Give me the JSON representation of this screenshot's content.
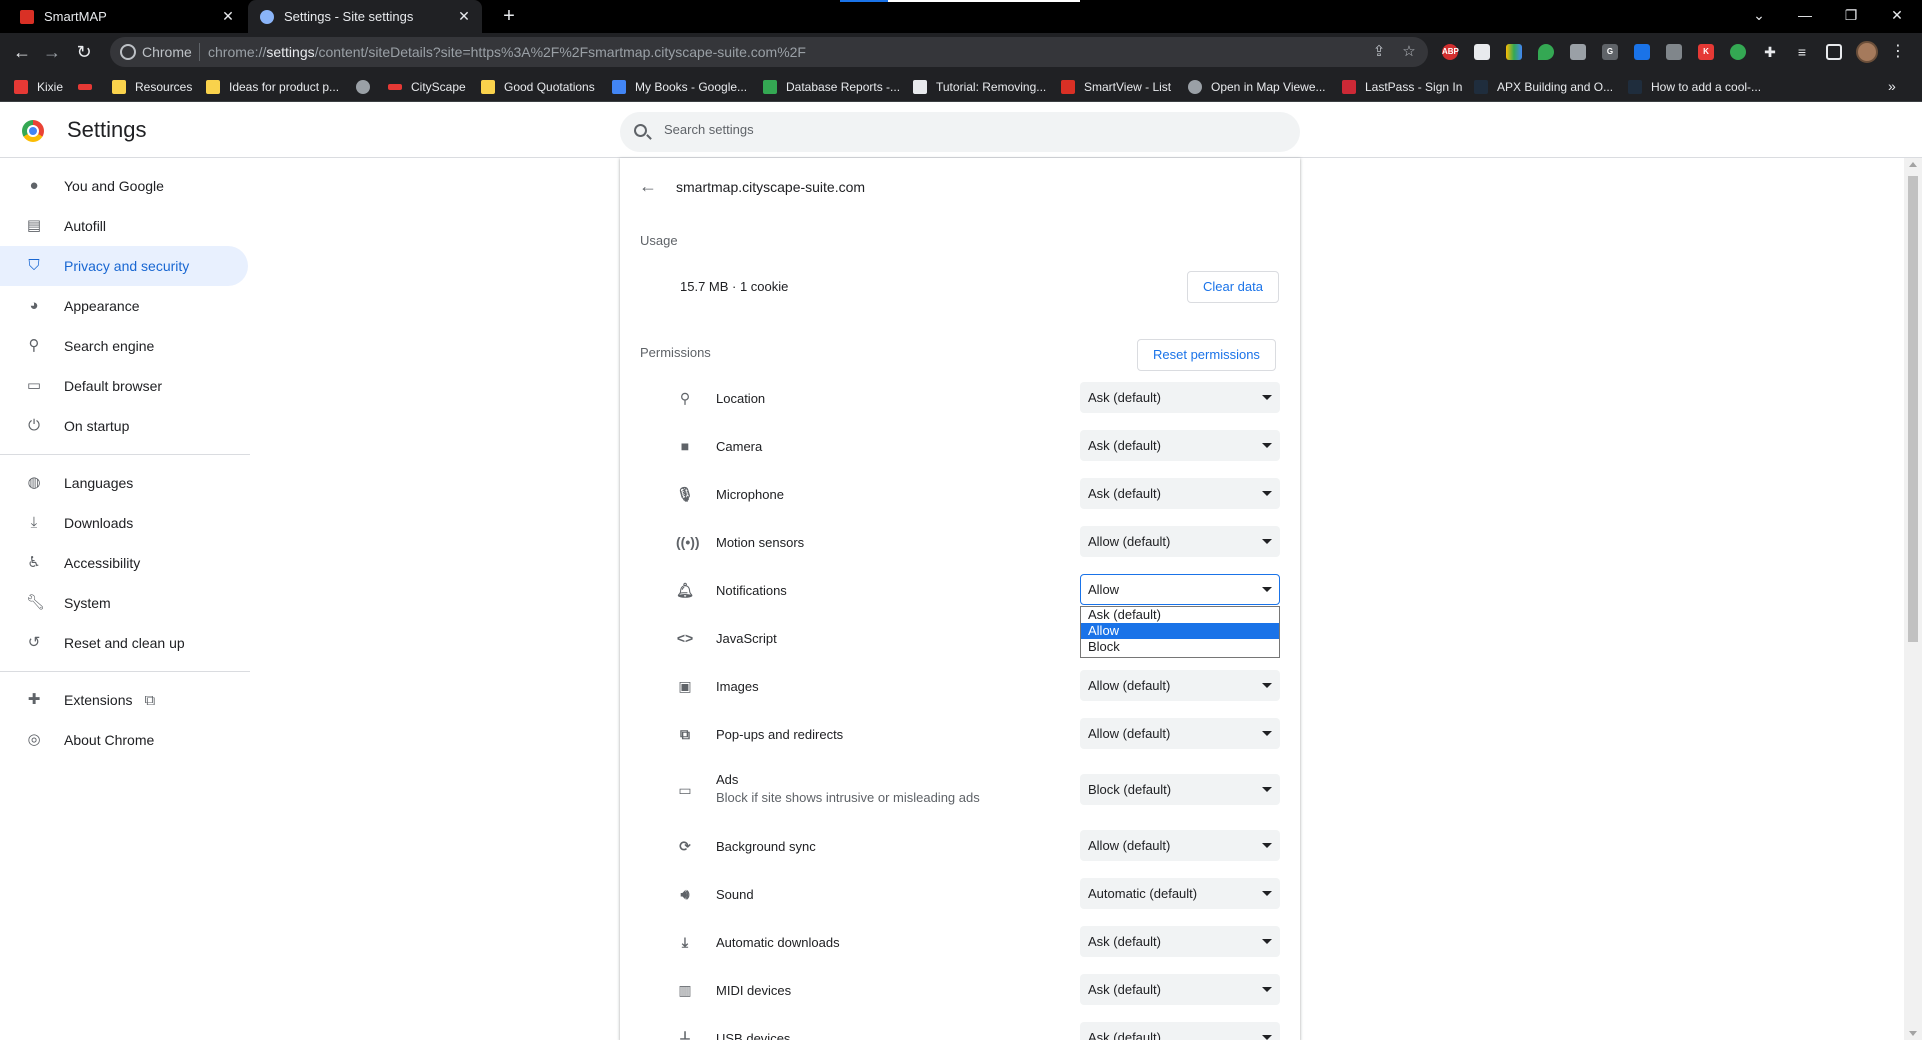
{
  "tabs": [
    {
      "title": "SmartMAP",
      "active": false
    },
    {
      "title": "Settings - Site settings",
      "active": true
    }
  ],
  "omnibox": {
    "chip": "Chrome",
    "url_prefix": "chrome://",
    "url_host": "settings",
    "url_rest": "/content/siteDetails?site=https%3A%2F%2Fsmartmap.cityscape-suite.com%2F"
  },
  "bookmarks": [
    {
      "label": "Kixie",
      "icon": "kixie-icon",
      "color": "#e53935"
    },
    {
      "label": "",
      "icon": "apx-icon",
      "color": "#e53935"
    },
    {
      "label": "Resources",
      "icon": "folder-icon",
      "color": "#f9d24c"
    },
    {
      "label": "Ideas for product p...",
      "icon": "folder-icon",
      "color": "#f9d24c"
    },
    {
      "label": "",
      "icon": "globe-icon",
      "color": "#9aa0a6"
    },
    {
      "label": "CityScape",
      "icon": "apx-icon",
      "color": "#e53935"
    },
    {
      "label": "Good Quotations",
      "icon": "folder-icon",
      "color": "#f9d24c"
    },
    {
      "label": "My Books - Google...",
      "icon": "play-books-icon",
      "color": "#4285f4"
    },
    {
      "label": "Database Reports -...",
      "icon": "sheets-icon",
      "color": "#34a853"
    },
    {
      "label": "Tutorial: Removing...",
      "icon": "doc-icon",
      "color": "#e8eaed"
    },
    {
      "label": "SmartView - List",
      "icon": "smartmap-icon",
      "color": "#d93025"
    },
    {
      "label": "Open in Map Viewe...",
      "icon": "globe-icon",
      "color": "#9aa0a6"
    },
    {
      "label": "LastPass - Sign In",
      "icon": "lastpass-icon",
      "color": "#cc2936"
    },
    {
      "label": "APX Building and O...",
      "icon": "apx-building-icon",
      "color": "#1f2d3d"
    },
    {
      "label": "How to add a cool-...",
      "icon": "apx-building-icon",
      "color": "#1f2d3d"
    }
  ],
  "header": {
    "title": "Settings",
    "search_placeholder": "Search settings"
  },
  "sidebar": {
    "items": [
      {
        "label": "You and Google",
        "icon": "person-icon",
        "active": false
      },
      {
        "label": "Autofill",
        "icon": "clipboard-icon",
        "active": false
      },
      {
        "label": "Privacy and security",
        "icon": "shield-icon",
        "active": true
      },
      {
        "label": "Appearance",
        "icon": "palette-icon",
        "active": false
      },
      {
        "label": "Search engine",
        "icon": "search-icon",
        "active": false
      },
      {
        "label": "Default browser",
        "icon": "browser-icon",
        "active": false
      },
      {
        "label": "On startup",
        "icon": "power-icon",
        "active": false
      },
      {
        "label": "Languages",
        "icon": "globe-icon",
        "active": false
      },
      {
        "label": "Downloads",
        "icon": "download-icon",
        "active": false
      },
      {
        "label": "Accessibility",
        "icon": "accessibility-icon",
        "active": false
      },
      {
        "label": "System",
        "icon": "wrench-icon",
        "active": false
      },
      {
        "label": "Reset and clean up",
        "icon": "history-icon",
        "active": false
      },
      {
        "label": "Extensions",
        "icon": "puzzle-icon",
        "active": false
      },
      {
        "label": "About Chrome",
        "icon": "chrome-icon",
        "active": false
      }
    ]
  },
  "site": {
    "host": "smartmap.cityscape-suite.com",
    "usage_label": "Usage",
    "usage_value": "15.7 MB · 1 cookie",
    "clear_data_label": "Clear data",
    "permissions_label": "Permissions",
    "reset_permissions_label": "Reset permissions"
  },
  "permissions": [
    {
      "name": "Location",
      "icon": "location-icon",
      "value": "Ask (default)"
    },
    {
      "name": "Camera",
      "icon": "camera-icon",
      "value": "Ask (default)"
    },
    {
      "name": "Microphone",
      "icon": "microphone-icon",
      "value": "Ask (default)"
    },
    {
      "name": "Motion sensors",
      "icon": "sensors-icon",
      "value": "Allow (default)"
    },
    {
      "name": "Notifications",
      "icon": "bell-icon",
      "value": "Allow",
      "open": true
    },
    {
      "name": "JavaScript",
      "icon": "code-icon",
      "value": ""
    },
    {
      "name": "Images",
      "icon": "image-icon",
      "value": "Allow (default)"
    },
    {
      "name": "Pop-ups and redirects",
      "icon": "open-in-new-icon",
      "value": "Allow (default)"
    },
    {
      "name": "Ads",
      "icon": "ads-icon",
      "value": "Block (default)",
      "sub": "Block if site shows intrusive or misleading ads"
    },
    {
      "name": "Background sync",
      "icon": "sync-icon",
      "value": "Allow (default)"
    },
    {
      "name": "Sound",
      "icon": "volume-icon",
      "value": "Automatic (default)"
    },
    {
      "name": "Automatic downloads",
      "icon": "download-icon",
      "value": "Ask (default)"
    },
    {
      "name": "MIDI devices",
      "icon": "piano-icon",
      "value": "Ask (default)"
    },
    {
      "name": "USB devices",
      "icon": "usb-icon",
      "value": "Ask (default)"
    }
  ],
  "notifications_dropdown": {
    "options": [
      "Ask (default)",
      "Allow",
      "Block"
    ],
    "selected": "Allow"
  }
}
